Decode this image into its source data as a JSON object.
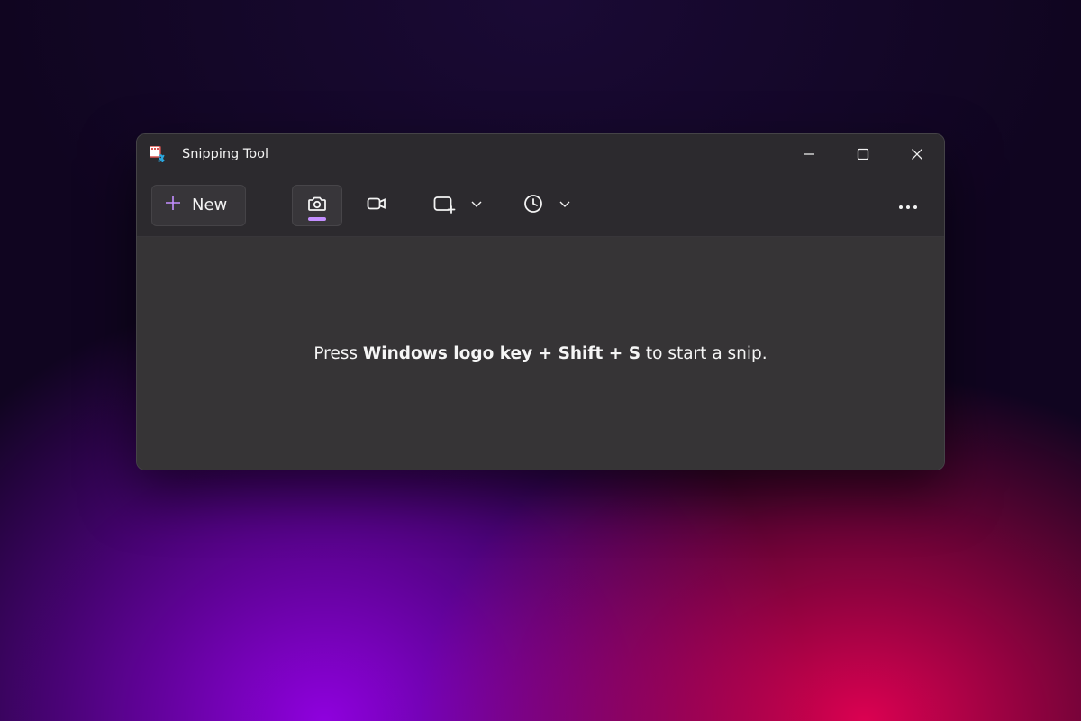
{
  "titlebar": {
    "title": "Snipping Tool"
  },
  "toolbar": {
    "new_label": "New"
  },
  "hint": {
    "pre": "Press ",
    "key1": "Windows logo key ",
    "plus1": "+",
    "key2": " Shift ",
    "plus2": "+",
    "key3": " S",
    "post": " to start a snip."
  }
}
